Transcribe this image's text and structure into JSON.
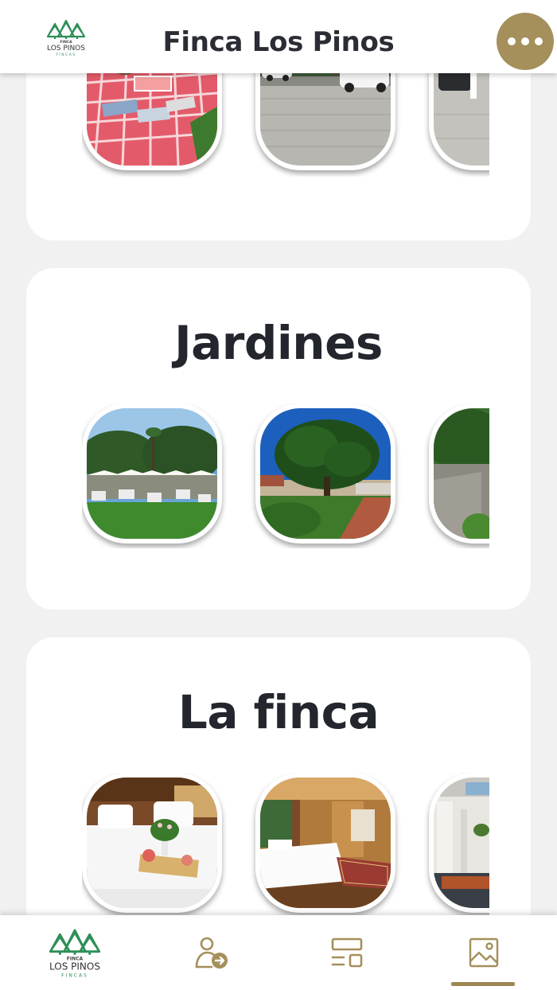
{
  "header": {
    "title": "Finca Los Pinos",
    "logo": {
      "top_text": "FINCA",
      "main_text": "LOS PINOS",
      "bottom_text": "FINCAS"
    },
    "menu_icon": "more-horizontal-icon"
  },
  "sections": [
    {
      "title": "",
      "photos": [
        "picnic-blanket-photo",
        "parking-cars-photo",
        "parked-suv-photo"
      ]
    },
    {
      "title": "Jardines",
      "photos": [
        "garden-event-umbrellas-photo",
        "garden-tree-photo",
        "garden-path-photo"
      ]
    },
    {
      "title": "La finca",
      "photos": [
        "bedroom-breakfast-tray-photo",
        "bedroom-suite-photo",
        "patio-interior-photo"
      ]
    }
  ],
  "bottom_nav": {
    "items": [
      {
        "id": "home",
        "icon": "los-pinos-logo-icon"
      },
      {
        "id": "profile",
        "icon": "user-arrow-icon"
      },
      {
        "id": "services",
        "icon": "layout-list-icon"
      },
      {
        "id": "gallery",
        "icon": "image-icon",
        "active": true
      }
    ]
  },
  "colors": {
    "accent": "#a58f5b",
    "logo_green": "#2e8f57",
    "text": "#2a2d33",
    "background": "#f1f1f1"
  }
}
